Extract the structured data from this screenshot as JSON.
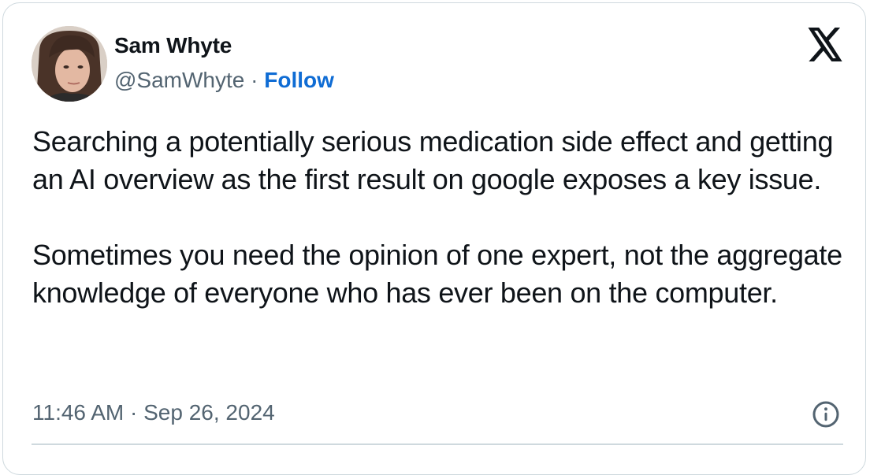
{
  "author": {
    "name": "Sam Whyte",
    "handle": "@SamWhyte",
    "separator": "·",
    "follow_label": "Follow"
  },
  "tweet": {
    "text": "Searching a potentially serious medication side effect and getting an AI overview as the first result on google exposes a key issue.\n\nSometimes you need the opinion of one expert, not the aggregate knowledge of everyone who has ever been on the computer.",
    "time": "11:46 AM",
    "date": "Sep 26, 2024",
    "time_separator": "·"
  },
  "icons": {
    "brand": "x-logo-icon",
    "info": "info-icon",
    "avatar": "avatar"
  },
  "colors": {
    "link": "#0f6cd4",
    "secondary_text": "#536471",
    "border": "#cfd9de",
    "text": "#0f1419"
  }
}
